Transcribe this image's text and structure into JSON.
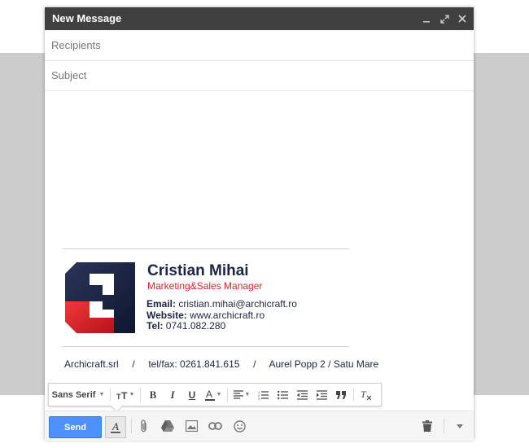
{
  "window": {
    "title": "New Message"
  },
  "fields": {
    "recipients_placeholder": "Recipients",
    "subject_placeholder": "Subject"
  },
  "signature": {
    "name": "Cristian Mihai",
    "role": "Marketing&Sales Manager",
    "email_label": "Email:",
    "email": "cristian.mihai@archicraft.ro",
    "website_label": "Website:",
    "website": "www.archicraft.ro",
    "tel_label": "Tel:",
    "tel": "0741.082.280",
    "footer": "Archicraft.srl     /     tel/fax: 0261.841.615     /     Aurel Popp 2 / Satu Mare"
  },
  "toolbar": {
    "font": "Sans Serif"
  },
  "bottom": {
    "send_label": "Send"
  },
  "colors": {
    "titlebar": "#404040",
    "send": "#4d90fe",
    "brand_navy": "#1c2545",
    "brand_red": "#e4222b"
  },
  "icons": [
    "minimize-icon",
    "expand-icon",
    "close-icon",
    "text-size-icon",
    "bold-icon",
    "italic-icon",
    "underline-icon",
    "text-color-icon",
    "align-icon",
    "numbered-list-icon",
    "bulleted-list-icon",
    "indent-less-icon",
    "indent-more-icon",
    "quote-icon",
    "remove-formatting-icon",
    "formatting-icon",
    "attach-icon",
    "drive-icon",
    "photo-icon",
    "link-icon",
    "emoji-icon",
    "trash-icon",
    "more-options-icon"
  ]
}
